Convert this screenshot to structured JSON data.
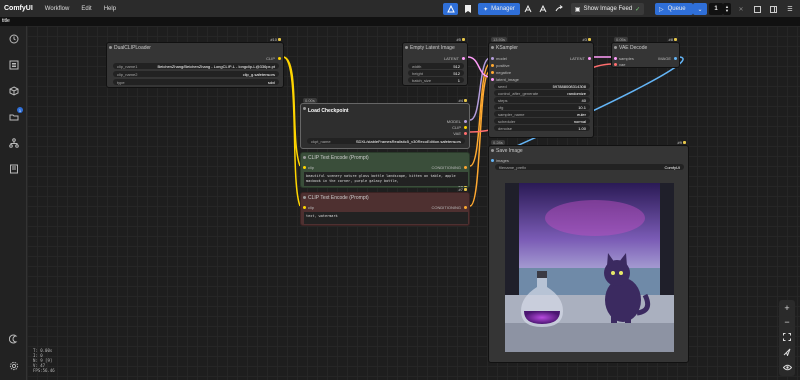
{
  "menubar": {
    "logo": "ComfyUI",
    "menus": [
      "Workflow",
      "Edit",
      "Help"
    ],
    "manager_label": "Manager",
    "feed_label": "Show Image Feed",
    "queue_label": "Queue",
    "queue_count": "1"
  },
  "tab": {
    "label": "title"
  },
  "sidebar": {
    "badge_count": "1"
  },
  "stats": [
    "T: 0.00s",
    "I: 0",
    "N: 9 [9]",
    "V: 47",
    "FPS:56.46"
  ],
  "nodes": {
    "dualclip": {
      "title": "DualCLIPLoader",
      "id": "#10",
      "output": "CLIP",
      "widgets": [
        {
          "label": "clip_name1",
          "value": "BeichenZhang/BeichenZhang - LongCLIP-L - longclip-L@336px.pt"
        },
        {
          "label": "clip_name2",
          "value": "clip_g.safetensors"
        },
        {
          "label": "type",
          "value": "sdxl"
        }
      ]
    },
    "latent": {
      "title": "Empty Latent Image",
      "id": "#5",
      "output": "LATENT",
      "widgets": [
        {
          "label": "width",
          "value": "512"
        },
        {
          "label": "height",
          "value": "512"
        },
        {
          "label": "batch_size",
          "value": "1"
        }
      ]
    },
    "ksampler": {
      "title": "KSampler",
      "id": "#3",
      "badge": "13.93s",
      "inputs": [
        "model",
        "positive",
        "negative",
        "latent_image"
      ],
      "output": "LATENT",
      "widgets": [
        {
          "label": "seed",
          "value": "597888008314308"
        },
        {
          "label": "control_after_generate",
          "value": "randomize"
        },
        {
          "label": "steps",
          "value": "40"
        },
        {
          "label": "cfg",
          "value": "10.1"
        },
        {
          "label": "sampler_name",
          "value": "euler"
        },
        {
          "label": "scheduler",
          "value": "normal"
        },
        {
          "label": "denoise",
          "value": "1.00"
        }
      ]
    },
    "vaedecode": {
      "title": "VAE Decode",
      "id": "#8",
      "badge": "0.05s",
      "inputs": [
        "samples",
        "vae"
      ],
      "output": "IMAGE"
    },
    "checkpoint": {
      "title": "Load Checkpoint",
      "id": "#4",
      "badge": "0.00s",
      "outputs": [
        "MODEL",
        "CLIP",
        "VAE"
      ],
      "widget": {
        "label": "ckpt_name",
        "value": "SDXL/stableFramesRealistic5_v30RecoEdition.safetensors"
      }
    },
    "pos": {
      "title": "CLIP Text Encode (Prompt)",
      "id": "#6",
      "input": "clip",
      "output": "CONDITIONING",
      "text": "beautiful scenery nature glass bottle landscape, kitten on table, apple macbook in the corner, purple galaxy bottle,"
    },
    "neg": {
      "title": "CLIP Text Encode (Prompt)",
      "id": "#7",
      "input": "clip",
      "output": "CONDITIONING",
      "text": "text, watermark"
    },
    "save": {
      "title": "Save Image",
      "id": "#9",
      "badge": "0.28s",
      "input": "images",
      "widget": {
        "label": "filename_prefix",
        "value": "ComfyUI"
      }
    }
  },
  "colors": {
    "accent": "#2f6fd8",
    "pos_node": "#3a4e3a",
    "neg_node": "#4e3030",
    "link_latent": "#ff9cf9",
    "link_clip": "#ffd500",
    "link_vae": "#ff6e6e",
    "link_cond": "#ffa931",
    "link_image": "#64b5f6",
    "link_model": "#b39ddb"
  }
}
